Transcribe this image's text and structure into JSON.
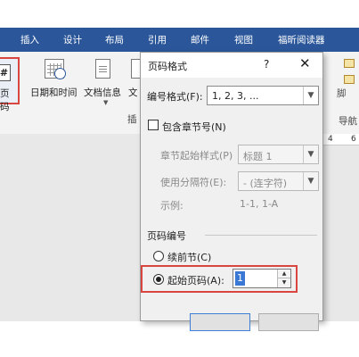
{
  "ribbon": {
    "tabs": [
      "插入",
      "设计",
      "布局",
      "引用",
      "邮件",
      "视图",
      "福昕阅读器"
    ],
    "page_number_label": "页码",
    "page_number_glyph": "#",
    "datetime_label": "日期和时间",
    "docinfo_label": "文档信息",
    "docinfo_fragment": "文",
    "insert_group_fragment": "插",
    "footer_fragment": "脚",
    "navigation_fragment": "导航"
  },
  "ruler": {
    "ticks": [
      "4",
      "6"
    ]
  },
  "dialog": {
    "title": "页码格式",
    "help": "?",
    "close": "✕",
    "number_format_label": "编号格式(F):",
    "number_format_value": "1, 2, 3, ...",
    "include_chapter_label": "包含章节号(N)",
    "chapter_style_label": "章节起始样式(P)",
    "chapter_style_value": "标题 1",
    "separator_label": "使用分隔符(E):",
    "separator_value": "-  (连字符)",
    "example_label": "示例:",
    "example_value": "1-1, 1-A",
    "numbering_section": "页码编号",
    "continue_label": "续前节(C)",
    "start_at_label": "起始页码(A):",
    "start_at_value": "1"
  },
  "colors": {
    "ribbon_accent": "#2b579a",
    "highlight": "#d9453f"
  }
}
